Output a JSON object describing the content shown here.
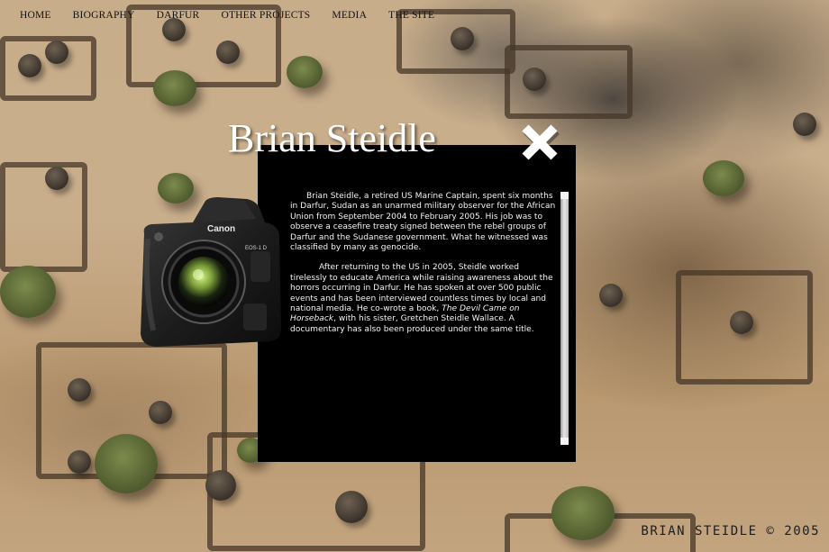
{
  "nav": {
    "items": [
      {
        "label": "HOME"
      },
      {
        "label": "BIOGRAPHY"
      },
      {
        "label": "DARFUR"
      },
      {
        "label": "OTHER PROJECTS"
      },
      {
        "label": "MEDIA"
      },
      {
        "label": "THE SITE"
      }
    ]
  },
  "page": {
    "title": "Brian Steidle"
  },
  "bio": {
    "p1": "Brian Steidle, a retired US Marine Captain, spent six months in Darfur, Sudan as an unarmed military observer for the African Union from September 2004 to February 2005. His job was to observe a ceasefire treaty signed between the rebel groups of Darfur and the Sudanese government. What he witnessed was classified by many as genocide.",
    "p2_before": "After returning to the US in 2005, Steidle worked tirelessly to educate America while raising awareness about the horrors occurring in Darfur. He has spoken at over 500 public events and has been interviewed countless times by local and national media. He co-wrote a book, ",
    "p2_book": "The Devil Came on Horseback",
    "p2_after": ", with his sister, Gretchen Steidle Wallace. A documentary has also been produced under the same title."
  },
  "camera": {
    "brand": "Canon",
    "model": "EOS-1 D"
  },
  "icons": {
    "close": "close-x-icon",
    "camera": "camera-icon"
  },
  "footer": {
    "text": "BRIAN STEIDLE © 2005"
  }
}
